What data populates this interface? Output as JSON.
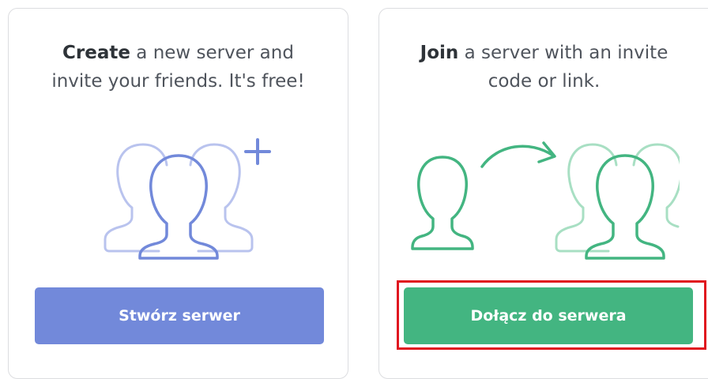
{
  "create_card": {
    "bold_text": "Create",
    "text_line1_rest": " a new server and",
    "text_line2": "invite your friends. It's free!",
    "button_label": "Stwórz serwer",
    "illustration_icon": "add-friends-icon",
    "accent_color": "#7289da"
  },
  "join_card": {
    "bold_text": "Join",
    "text_line1_rest": " a server with an invite",
    "text_line2": "code or link.",
    "button_label": "Dołącz do serwera",
    "illustration_icon": "join-server-icon",
    "accent_color": "#43b581"
  },
  "highlight_color": "#e0161f"
}
